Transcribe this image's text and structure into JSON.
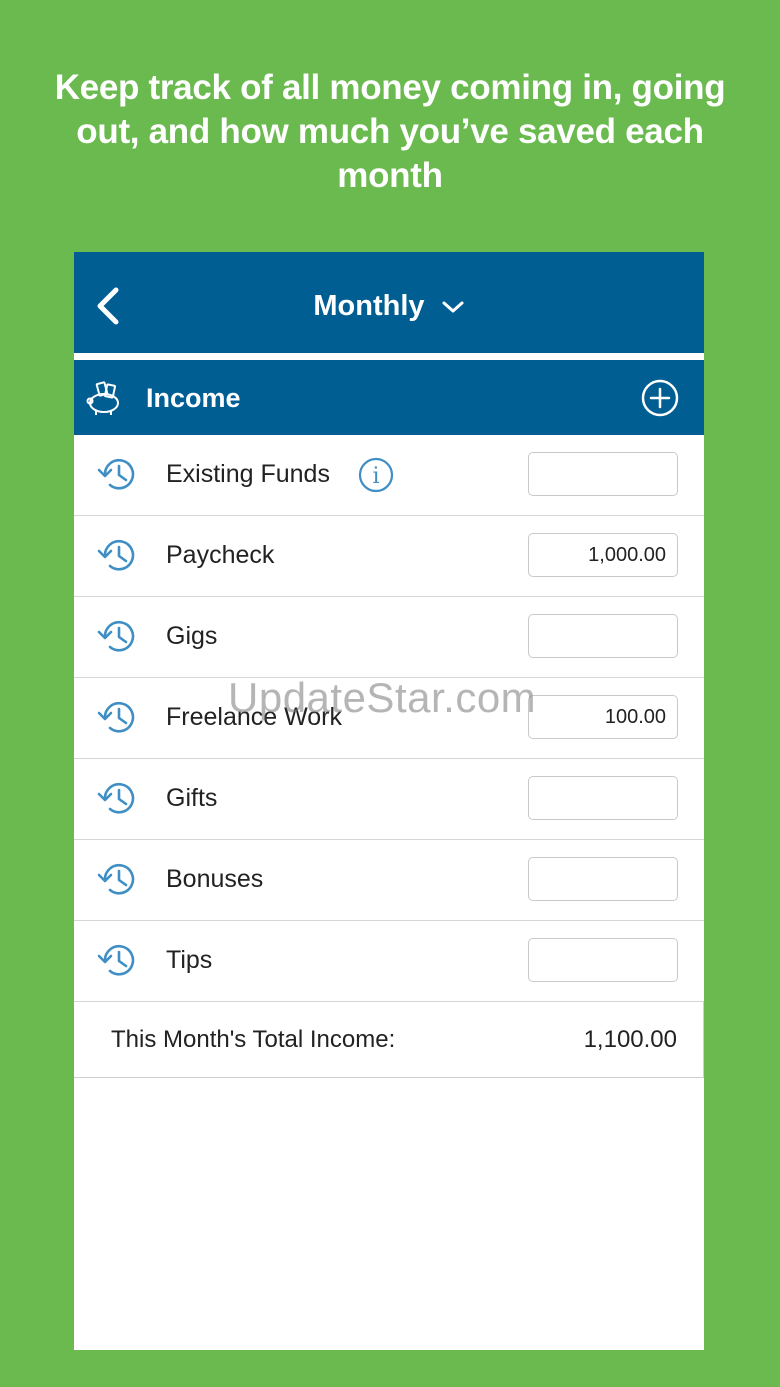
{
  "headline": "Keep track of all money coming in, going out, and how much you’ve saved each month",
  "navbar": {
    "title": "Monthly"
  },
  "section": {
    "title": "Income"
  },
  "rows": [
    {
      "label": "Existing Funds",
      "value": "",
      "info": true
    },
    {
      "label": "Paycheck",
      "value": "1,000.00"
    },
    {
      "label": "Gigs",
      "value": ""
    },
    {
      "label": "Freelance Work",
      "value": "100.00"
    },
    {
      "label": "Gifts",
      "value": ""
    },
    {
      "label": "Bonuses",
      "value": ""
    },
    {
      "label": "Tips",
      "value": ""
    }
  ],
  "total": {
    "label": "This Month's Total Income:",
    "value": "1,100.00"
  },
  "watermark": "UpdateStar.com",
  "colors": {
    "background": "#6aba4f",
    "primary": "#005e93",
    "icon": "#3f8ec4"
  },
  "icons": {
    "back": "chevron-left-icon",
    "title_dropdown": "chevron-down-icon",
    "section": "piggy-bank-icon",
    "add": "plus-circle-icon",
    "row": "history-icon",
    "info": "info-icon"
  }
}
